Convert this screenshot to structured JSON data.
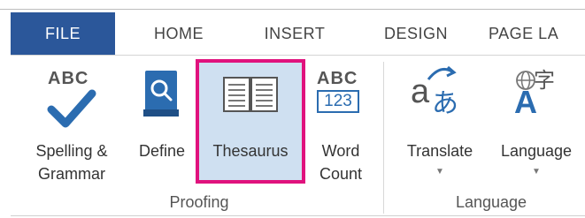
{
  "tabs": [
    "FILE",
    "HOME",
    "INSERT",
    "DESIGN",
    "PAGE LA"
  ],
  "proofing": {
    "spelling_label_1": "Spelling &",
    "spelling_label_2": "Grammar",
    "spelling_icon_text": "ABC",
    "define_label": "Define",
    "thesaurus_label": "Thesaurus",
    "wordcount_label_1": "Word",
    "wordcount_label_2": "Count",
    "wordcount_icon_top": "ABC",
    "wordcount_icon_bottom": "123",
    "group_label": "Proofing"
  },
  "language": {
    "translate_label": "Translate",
    "language_label": "Language",
    "translate_icon_a": "a",
    "translate_icon_jp": "あ",
    "language_icon_a": "A",
    "language_icon_ch": "字",
    "group_label": "Language"
  },
  "colors": {
    "file_tab": "#2b579a",
    "highlight_border": "#e0127d",
    "highlight_fill": "#cfe0f1",
    "icon_blue": "#2b6cb0"
  }
}
